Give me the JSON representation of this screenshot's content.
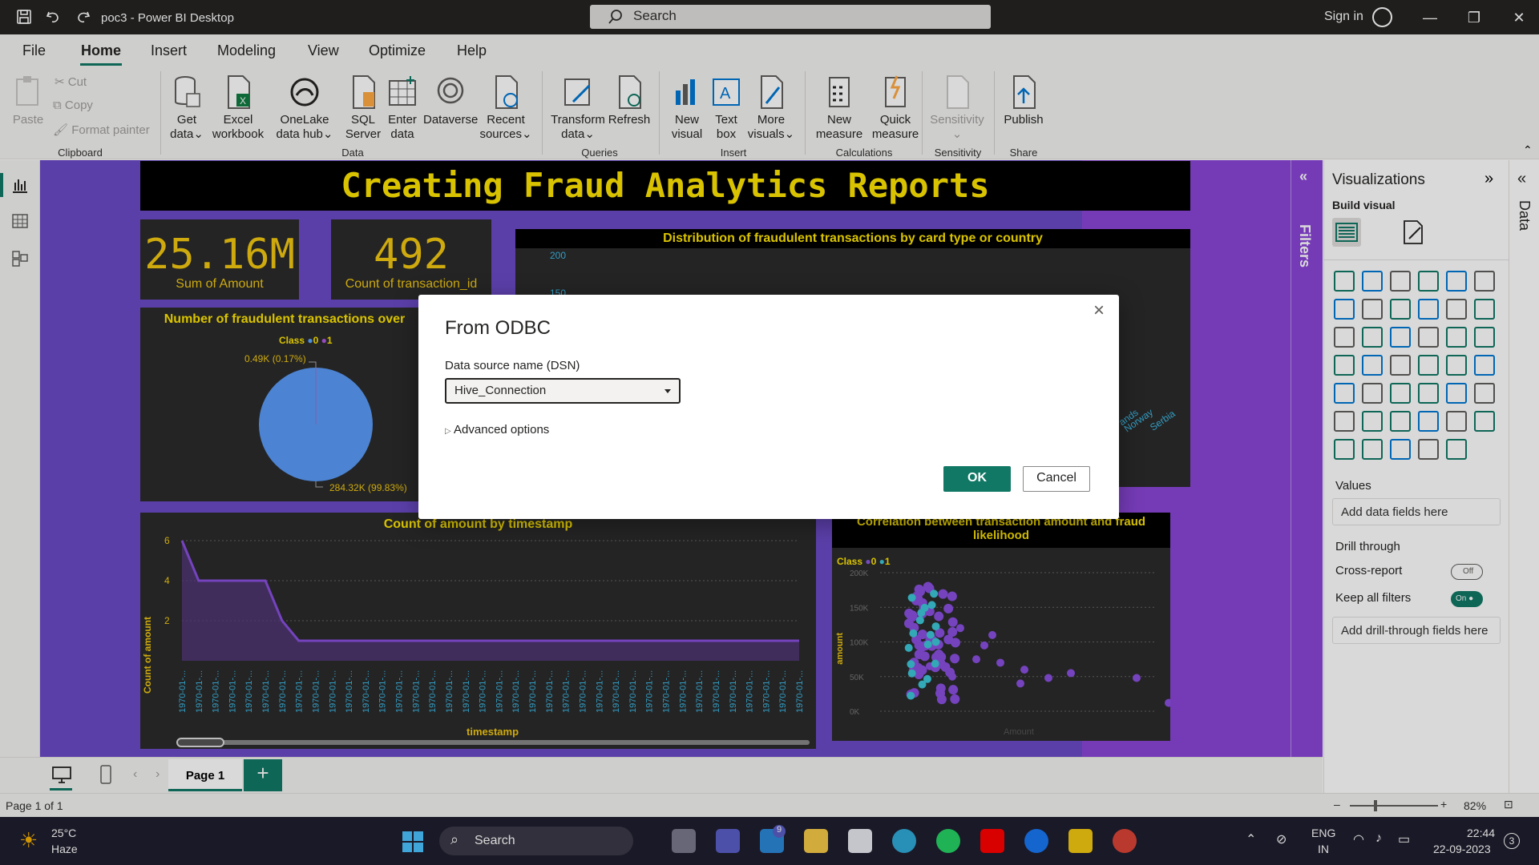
{
  "titlebar": {
    "title": "poc3 - Power BI Desktop",
    "search": "Search",
    "signin": "Sign in"
  },
  "menu": {
    "file": "File",
    "home": "Home",
    "insert": "Insert",
    "modeling": "Modeling",
    "view": "View",
    "optimize": "Optimize",
    "help": "Help"
  },
  "ribbon": {
    "paste": "Paste",
    "cut": "Cut",
    "copy": "Copy",
    "format_painter": "Format painter",
    "clipboard": "Clipboard",
    "get_data": "Get data",
    "excel": "Excel workbook",
    "onelake": "OneLake data hub",
    "sql": "SQL Server",
    "enter": "Enter data",
    "dataverse": "Dataverse",
    "recent": "Recent sources",
    "data": "Data",
    "transform": "Transform data",
    "refresh": "Refresh",
    "queries": "Queries",
    "new_visual": "New visual",
    "text_box": "Text box",
    "more_visuals": "More visuals",
    "insert": "Insert",
    "new_measure": "New measure",
    "quick_measure": "Quick measure",
    "calculations": "Calculations",
    "sensitivity": "Sensitivity",
    "sensitivity_grp": "Sensitivity",
    "publish": "Publish",
    "share": "Share"
  },
  "report": {
    "banner": "Creating Fraud Analytics Reports",
    "kpi1_value": "25.16M",
    "kpi1_label": "Sum of Amount",
    "kpi2_value": "492",
    "kpi2_label": "Count of transaction_id",
    "pie_title": "Number of fraudulent transactions over",
    "pie_legend": "Class",
    "pie_leg0": "0",
    "pie_leg1": "1",
    "pie_small": "0.49K (0.17%)",
    "pie_big": "284.32K (99.83%)",
    "dist_title": "Distribution of fraudulent transactions by card type or country",
    "dist_y1": "200",
    "dist_y2": "150",
    "dist_c1": "ands",
    "dist_c2": "Norway",
    "dist_c3": "Serbia",
    "line_title": "Count of amount by timestamp",
    "line_ylabel": "Count of amount",
    "line_xlabel": "timestamp",
    "line_tick": "1970-01-...",
    "scatter_title": "Correlation between transaction amount and fraud likelihood",
    "scatter_legend": "Class",
    "scatter_leg0": "0",
    "scatter_leg1": "1",
    "scatter_ylabel": "amount",
    "scatter_xlabel": "Amount",
    "scatter_y": [
      "200K",
      "150K",
      "100K",
      "50K",
      "0K"
    ]
  },
  "chart_data": [
    {
      "type": "pie",
      "title": "Number of fraudulent transactions over",
      "categories": [
        "0",
        "1"
      ],
      "values": [
        284.32,
        0.49
      ],
      "labels": [
        "284.32K (99.83%)",
        "0.49K (0.17%)"
      ],
      "legend_title": "Class"
    },
    {
      "type": "line",
      "title": "Count of amount by timestamp",
      "xlabel": "timestamp",
      "ylabel": "Count of amount",
      "ylim": [
        0,
        6
      ],
      "y_ticks": [
        2,
        4,
        6
      ],
      "values": [
        6,
        4,
        4,
        4,
        4,
        4,
        2,
        1,
        1,
        1,
        1,
        1,
        1,
        1,
        1,
        1,
        1,
        1,
        1,
        1,
        1,
        1,
        1,
        1,
        1,
        1,
        1,
        1,
        1,
        1,
        1,
        1,
        1,
        1,
        1,
        1,
        1,
        1
      ]
    },
    {
      "type": "scatter",
      "title": "Correlation between transaction amount and fraud likelihood",
      "ylabel": "amount",
      "xlabel": "Amount",
      "y_ticks": [
        "0K",
        "50K",
        "100K",
        "150K",
        "200K"
      ],
      "legend_title": "Class",
      "series": [
        {
          "name": "0"
        },
        {
          "name": "1"
        }
      ]
    }
  ],
  "filters": "Filters",
  "viz": {
    "title": "Visualizations",
    "build": "Build visual",
    "values": "Values",
    "add_fields": "Add data fields here",
    "drill": "Drill through",
    "cross": "Cross-report",
    "cross_state": "Off",
    "keep": "Keep all filters",
    "keep_state": "On",
    "add_drill": "Add drill-through fields here",
    "data_rail": "Data"
  },
  "pages": {
    "page1": "Page 1",
    "status": "Page 1 of 1",
    "zoom": "82%"
  },
  "dialog": {
    "title": "From ODBC",
    "dsn_label": "Data source name (DSN)",
    "dsn_value": "Hive_Connection",
    "advanced": "Advanced options",
    "ok": "OK",
    "cancel": "Cancel"
  },
  "taskbar": {
    "temp": "25°C",
    "weather": "Haze",
    "search": "Search",
    "lang1": "ENG",
    "lang2": "IN",
    "time": "22:44",
    "date": "22-09-2023",
    "mail_badge": "9",
    "notif": "3"
  }
}
